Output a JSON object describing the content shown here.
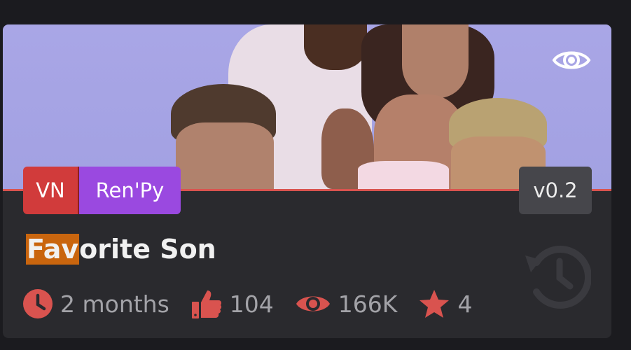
{
  "card": {
    "title_highlight": "Fav",
    "title_rest": "orite Son",
    "tags": [
      {
        "label": "VN",
        "color": "#d13b3b"
      },
      {
        "label": "Ren'Py",
        "color": "#9a49e0"
      }
    ],
    "version": "v0.2",
    "meta": {
      "time": "2 months",
      "likes": "104",
      "views": "166K",
      "rating": "4"
    },
    "icons": {
      "preview": "eye-icon",
      "time": "clock-icon",
      "likes": "thumbs-up-icon",
      "views": "eye-icon",
      "rating": "star-icon",
      "history": "history-icon"
    },
    "colors": {
      "accent": "#d9534f",
      "highlight": "#c9650e"
    }
  }
}
